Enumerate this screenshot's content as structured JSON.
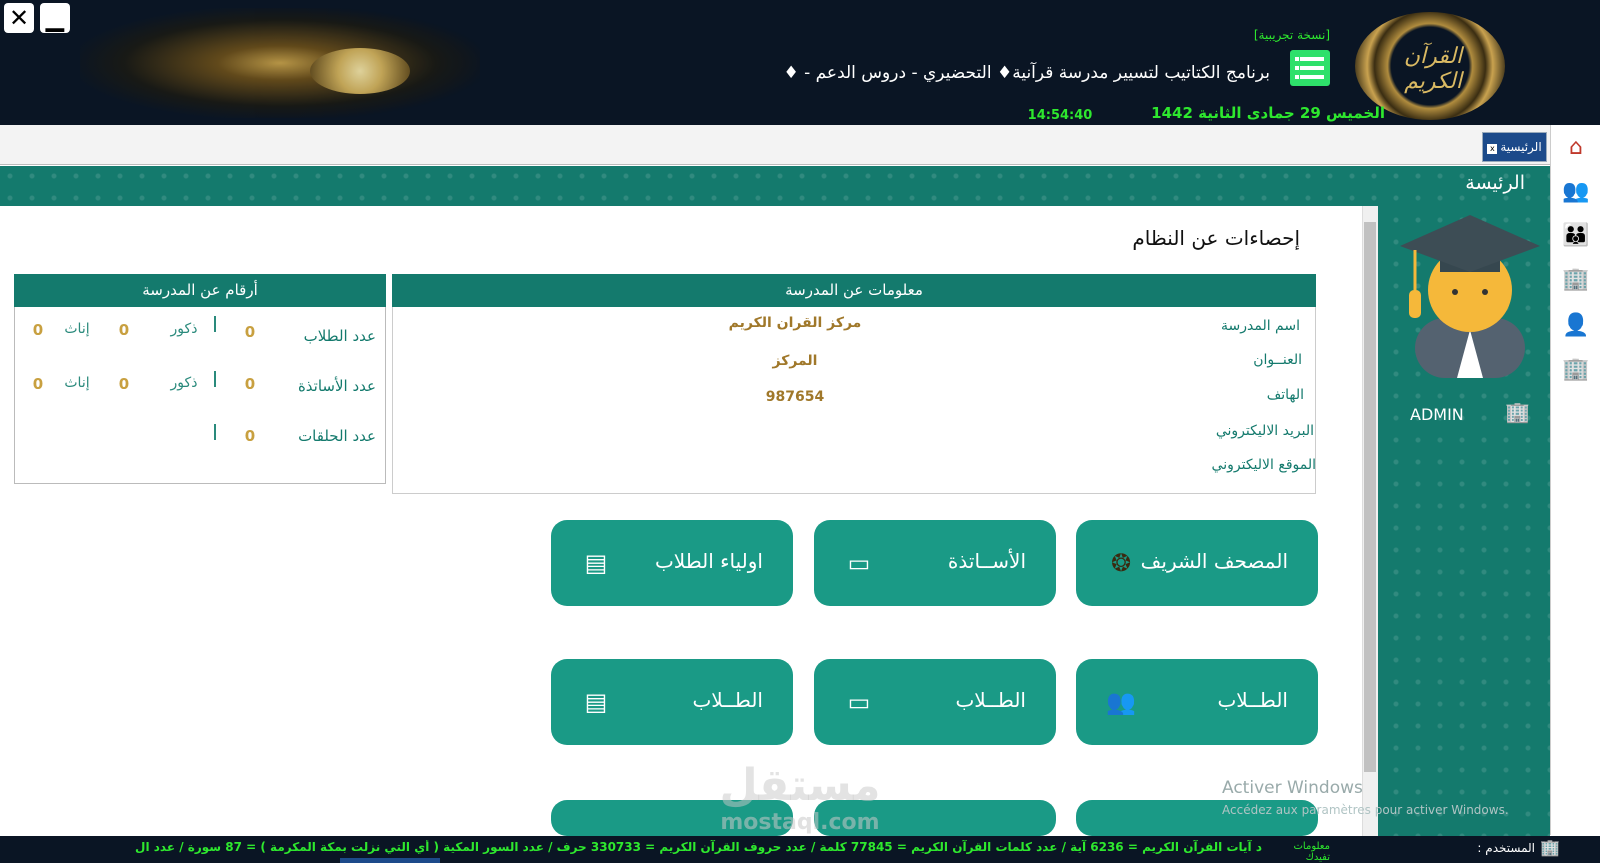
{
  "window": {
    "close_label": "✕",
    "minimize_label": "▁"
  },
  "header": {
    "trial_label": "[نسخة تجريبية]",
    "program_title": "برنامج الكتاتيب لتسيير مدرسة قرآنية♦ التحضيري - دروس الدعم - ♦",
    "hijri_date": "الخميس 29 جمادى الثانية 1442",
    "clock": "14:54:40",
    "logo_text": "القرآن الكريم"
  },
  "tabs": {
    "home_tab_label": "الرئيسية",
    "close_x": "x"
  },
  "page": {
    "heading": "الرئيسة",
    "stats_title": "إحصاءات عن النظام"
  },
  "sidebar": {
    "user_name": "ADMIN"
  },
  "school_info": {
    "header": "معلومات عن المدرسة",
    "labels": {
      "name": "اسم المدرسة",
      "address": "العنــوان",
      "phone": "الهاتف",
      "email": "البريد الاليكتروني",
      "website": "الموقع الاليكتروني"
    },
    "values": {
      "name": "مركز القران الكريم",
      "address": "المركز",
      "phone": "987654"
    }
  },
  "school_numbers": {
    "header": "أرقام عن المدرسة",
    "students_label": "عدد الطلاب",
    "teachers_label": "عدد الأساتذة",
    "circles_label": "عدد الحلقات",
    "male_label": "ذكور",
    "female_label": "إناث",
    "students_total": "0",
    "students_male": "0",
    "students_female": "0",
    "teachers_total": "0",
    "teachers_male": "0",
    "teachers_female": "0",
    "circles_total": "0"
  },
  "buttons": {
    "mushaf": "المصحف الشريف",
    "teachers": "الأســاتذة",
    "parents": "اولياء الطلاب",
    "students_1": "الطــلاب",
    "students_2": "الطــلاب",
    "students_3": "الطــلاب"
  },
  "watermark": {
    "activate_title": "Activer Windows",
    "activate_sub": "Accédez aux paramètres pour activer Windows.",
    "brand": "مستقل",
    "brand_sub": "mostaql.com"
  },
  "statusbar": {
    "user_label": "المستخدم :",
    "info_tag": "معلومات تفيدك",
    "ticker": "د آيات القرآن الكريم = 6236 آية / عدد كلمات القرآن الكريم = 77845 كلمة / عدد حروف القرآن الكريم = 330733 حرف / عدد السور المكية ( أي التي نزلت بمكة المكرمة ) = 87 سورة / عدد ال"
  },
  "colors": {
    "header_bg": "#0a1524",
    "teal": "#147a6d",
    "button_teal": "#1a9a86",
    "gold": "#c8a040",
    "status_green": "#2ee82e"
  }
}
